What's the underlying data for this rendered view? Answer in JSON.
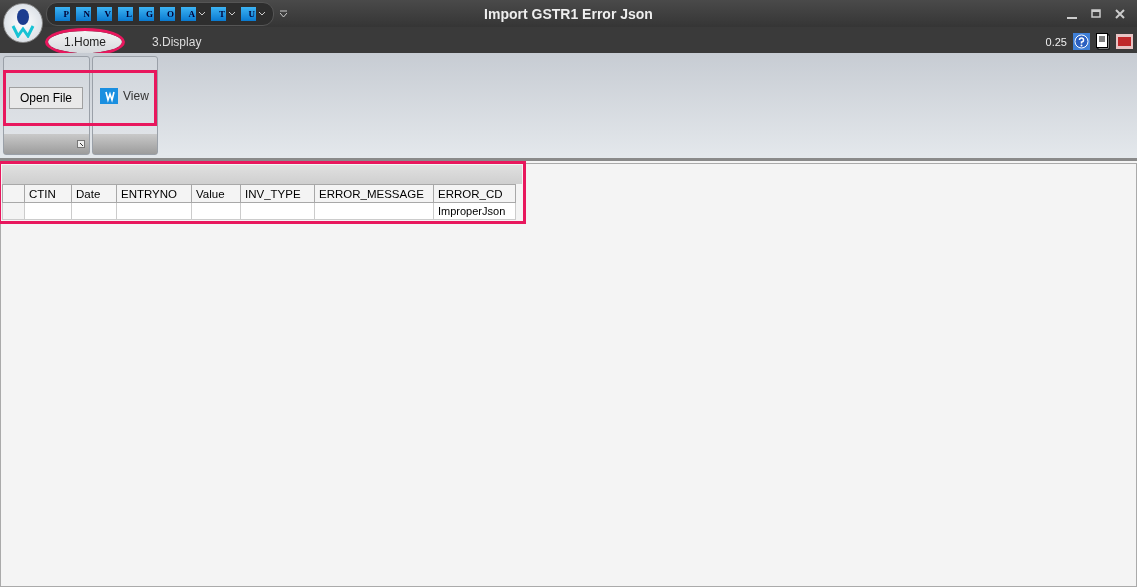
{
  "window": {
    "title": "Import GSTR1 Error Json"
  },
  "quick_access": [
    {
      "letter": "P",
      "dropdown": false
    },
    {
      "letter": "N",
      "dropdown": false
    },
    {
      "letter": "V",
      "dropdown": false
    },
    {
      "letter": "L",
      "dropdown": false
    },
    {
      "letter": "G",
      "dropdown": false
    },
    {
      "letter": "O",
      "dropdown": false
    },
    {
      "letter": "A",
      "dropdown": true
    },
    {
      "letter": "T",
      "dropdown": true
    },
    {
      "letter": "U",
      "dropdown": true
    }
  ],
  "tabs": [
    {
      "label": "1.Home",
      "selected": true,
      "circled": true
    },
    {
      "label": "3.Display",
      "selected": false,
      "circled": false
    }
  ],
  "version": "0.25",
  "ribbon": {
    "highlighted": true,
    "groups": [
      {
        "kind": "button",
        "label": "Open File",
        "launcher": true
      },
      {
        "kind": "icon_button",
        "label": "View",
        "launcher": false
      }
    ]
  },
  "grid": {
    "highlighted": true,
    "columns": [
      "CTIN",
      "Date",
      "ENTRYNO",
      "Value",
      "INV_TYPE",
      "ERROR_MESSAGE",
      "ERROR_CD"
    ],
    "rows": [
      [
        "",
        "",
        "",
        "",
        "",
        "",
        "ImproperJson"
      ]
    ]
  }
}
